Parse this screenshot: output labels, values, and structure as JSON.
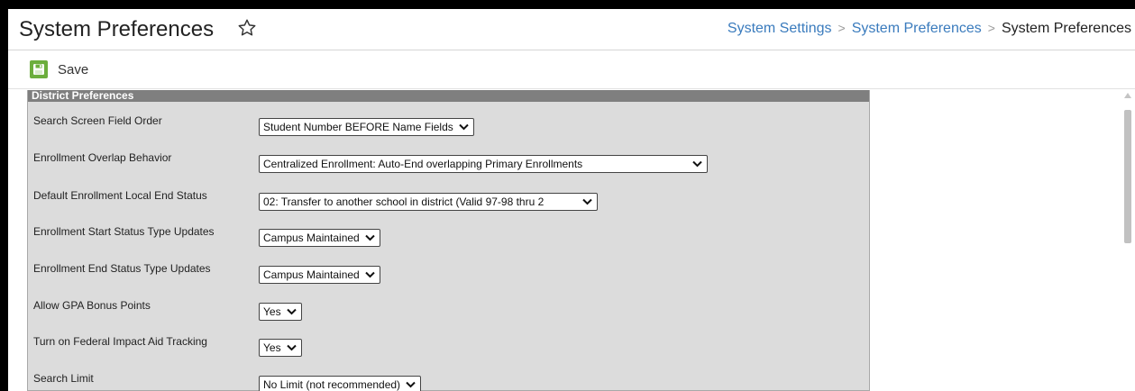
{
  "header": {
    "title": "System Preferences",
    "breadcrumb": [
      "System Settings",
      "System Preferences",
      "System Preferences"
    ]
  },
  "toolbar": {
    "save_label": "Save"
  },
  "panel": {
    "title": "District Preferences",
    "rows": [
      {
        "label": "Search Screen Field Order",
        "value": "Student Number BEFORE Name Fields"
      },
      {
        "label": "Enrollment Overlap Behavior",
        "value": "Centralized Enrollment: Auto-End overlapping Primary Enrollments"
      },
      {
        "label": "Default Enrollment Local End Status",
        "value": "02: Transfer to another school in district (Valid 97-98 thru 2"
      },
      {
        "label": "Enrollment Start Status Type Updates",
        "value": "Campus Maintained"
      },
      {
        "label": "Enrollment End Status Type Updates",
        "value": "Campus Maintained"
      },
      {
        "label": "Allow GPA Bonus Points",
        "value": "Yes"
      },
      {
        "label": "Turn on Federal Impact Aid Tracking",
        "value": "Yes"
      },
      {
        "label": "Search Limit",
        "value": "No Limit (not recommended)"
      }
    ]
  },
  "colors": {
    "accent_link": "#3a7bbd",
    "save_green": "#6cae3d",
    "panel_bg": "#dcdcdc",
    "panel_header_bg": "#7f7f7f"
  },
  "icons": {
    "favorite": "star-outline-icon",
    "save": "floppy-disk-icon",
    "dropdown": "chevron-down-icon"
  }
}
